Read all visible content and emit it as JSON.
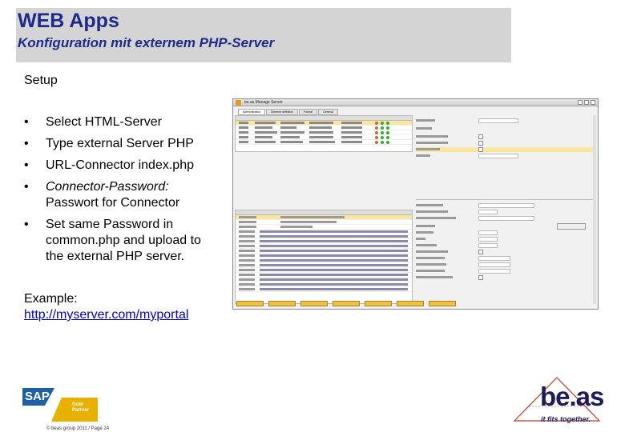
{
  "slide": {
    "title": "WEB Apps",
    "subtitle": "Konfiguration mit externem PHP-Server",
    "setup_heading": "Setup",
    "bullets": [
      {
        "symbol": "•",
        "text": "Select HTML-Server"
      },
      {
        "symbol": "•",
        "text": "Type external Server PHP"
      },
      {
        "symbol": "•",
        "text": "URL-Connector index.php"
      },
      {
        "symbol": "•",
        "text": "Connector-Password:"
      },
      {
        "symbol": "",
        "text": "Passwort for Connector"
      },
      {
        "symbol": "•",
        "text": "Set same Password in"
      },
      {
        "symbol": "",
        "text": "common.php and upload to"
      },
      {
        "symbol": "",
        "text": "the external PHP server."
      }
    ],
    "example_label": "Example:",
    "example_link": "http://myserver.com/myportal"
  },
  "screenshot": {
    "window_title": "be.as Manage Server",
    "tabs": [
      "Administration",
      "Element definition",
      "Format",
      "General"
    ]
  },
  "logos": {
    "sap_text": "SAP",
    "sap_badge_line1": "Gold",
    "sap_badge_line2": "Partner",
    "beas_name": "be.as",
    "beas_tagline": "it fits together."
  },
  "footer": {
    "text": "© beas group 2011 / Page 24"
  },
  "colors": {
    "title": "#1d2a8a",
    "title_bar": "#d4d4d4",
    "link": "#0000c0",
    "highlight_row": "#fbe6a0",
    "sap_blue": "#1e5fa8",
    "sap_gold": "#e8b100"
  }
}
